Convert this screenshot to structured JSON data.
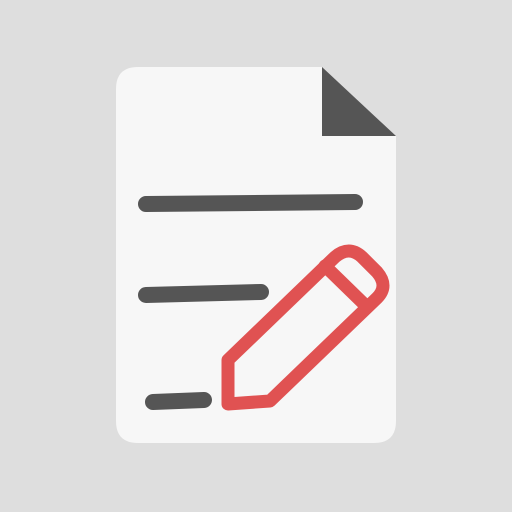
{
  "icon": {
    "name": "edit-document-icon",
    "components": [
      "document-page-icon",
      "folded-corner-icon",
      "text-line-icons",
      "pencil-icon"
    ]
  },
  "colors": {
    "background": "#dedede",
    "page": "#f7f7f7",
    "corner_fold": "#555555",
    "text_lines": "#555555",
    "pencil": "#e05252"
  }
}
